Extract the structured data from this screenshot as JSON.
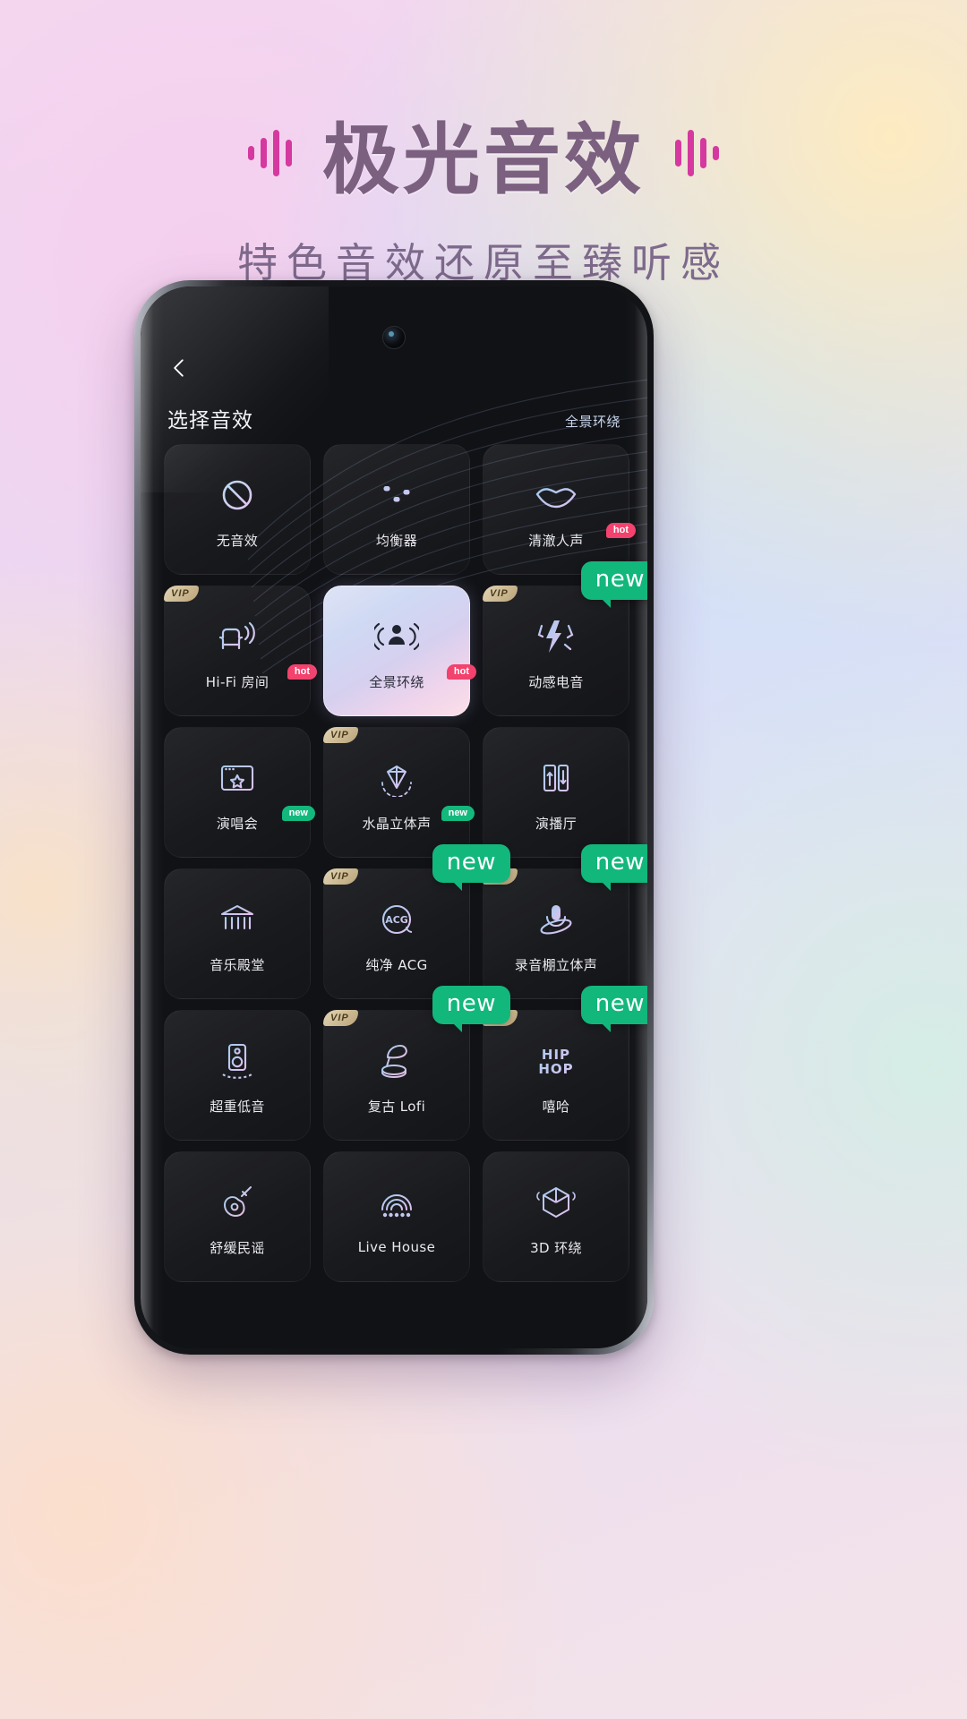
{
  "banner": {
    "title": "极光音效",
    "subtitle": "特色音效还原至臻听感",
    "title_color": "#7b6080",
    "wave_color": "#d5399f",
    "subtitle_color": "#7e6a8c"
  },
  "app": {
    "back_label": "返回",
    "page_title": "选择音效",
    "current_effect": "全景环绕",
    "accent_green": "#12b77c",
    "accent_hot": "#f2426d",
    "vip_gold": "#b9a277"
  },
  "effects": [
    {
      "label": "无音效",
      "icon": "no-sound-icon",
      "vip": false,
      "badge": "",
      "bubble": "",
      "selected": false
    },
    {
      "label": "均衡器",
      "icon": "equalizer-icon",
      "vip": false,
      "badge": "",
      "bubble": "",
      "selected": false
    },
    {
      "label": "清澈人声",
      "icon": "lips-icon",
      "vip": false,
      "badge": "hot",
      "bubble": "",
      "selected": false
    },
    {
      "label": "Hi-Fi 房间",
      "icon": "armchair-icon",
      "vip": true,
      "badge": "hot",
      "bubble": "",
      "selected": false
    },
    {
      "label": "全景环绕",
      "icon": "surround-person-icon",
      "vip": false,
      "badge": "hot",
      "bubble": "",
      "selected": true
    },
    {
      "label": "动感电音",
      "icon": "lightning-icon",
      "vip": true,
      "badge": "",
      "bubble": "new",
      "selected": false
    },
    {
      "label": "演唱会",
      "icon": "concert-stage-icon",
      "vip": false,
      "badge": "new",
      "bubble": "",
      "selected": false
    },
    {
      "label": "水晶立体声",
      "icon": "crystal-icon",
      "vip": true,
      "badge": "new",
      "bubble": "",
      "selected": false
    },
    {
      "label": "演播厅",
      "icon": "studio-icon",
      "vip": false,
      "badge": "",
      "bubble": "",
      "selected": false
    },
    {
      "label": "音乐殿堂",
      "icon": "temple-icon",
      "vip": false,
      "badge": "",
      "bubble": "",
      "selected": false
    },
    {
      "label": "纯净 ACG",
      "icon": "acg-icon",
      "vip": true,
      "badge": "",
      "bubble": "new",
      "selected": false
    },
    {
      "label": "录音棚立体声",
      "icon": "mic-orbit-icon",
      "vip": true,
      "badge": "",
      "bubble": "new",
      "selected": false
    },
    {
      "label": "超重低音",
      "icon": "subwoofer-icon",
      "vip": false,
      "badge": "",
      "bubble": "",
      "selected": false
    },
    {
      "label": "复古 Lofi",
      "icon": "gramophone-icon",
      "vip": true,
      "badge": "",
      "bubble": "new",
      "selected": false
    },
    {
      "label": "嘻哈",
      "icon": "hiphop-text-icon",
      "vip": true,
      "badge": "",
      "bubble": "new",
      "selected": false
    },
    {
      "label": "舒缓民谣",
      "icon": "guitar-icon",
      "vip": false,
      "badge": "",
      "bubble": "",
      "selected": false
    },
    {
      "label": "Live House",
      "icon": "livehouse-icon",
      "vip": false,
      "badge": "",
      "bubble": "",
      "selected": false
    },
    {
      "label": "3D 环绕",
      "icon": "cube-3d-icon",
      "vip": false,
      "badge": "",
      "bubble": "",
      "selected": false
    }
  ],
  "vip_text": "VIP"
}
